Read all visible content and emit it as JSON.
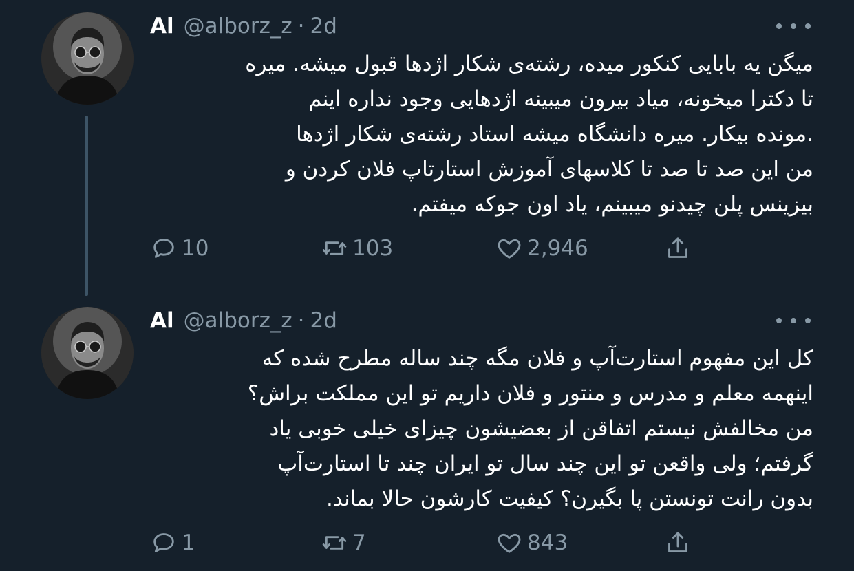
{
  "tweets": [
    {
      "name": "Al",
      "handle": "@alborz_z",
      "separator": "·",
      "time": "2d",
      "body_lines": [
        "میگن یه بابایی کنکور میده، رشته‌ی شکار اژدها قبول میشه. میره",
        "تا دکترا میخونه، میاد بیرون میبینه اژدهایی وجود نداره اینم",
        ".مونده بیکار. میره دانشگاه میشه استاد رشته‌ی شکار اژدها",
        "من این صد تا صد تا کلاسهای آموزش استارتاپ فلان کردن و",
        "بیزینس پلن چیدنو میبینم، یاد اون جوکه میفتم."
      ],
      "replies": "10",
      "retweets": "103",
      "likes": "2,946"
    },
    {
      "name": "Al",
      "handle": "@alborz_z",
      "separator": "·",
      "time": "2d",
      "body_lines": [
        "کل این مفهوم استارت‌آپ و فلان مگه چند ساله مطرح شده که",
        "اینهمه معلم و مدرس و منتور و فلان داریم تو این مملکت براش؟",
        "من مخالفش نیستم اتفاقن از بعضیشون چیزای خیلی خوبی یاد",
        "گرفتم؛ ولی واقعن تو این چند سال تو ایران چند تا استارت‌آپ",
        "بدون رانت تونستن پا بگیرن؟ کیفیت کارشون حالا بماند."
      ],
      "replies": "1",
      "retweets": "7",
      "likes": "843"
    }
  ],
  "icons": {
    "reply": "reply-icon",
    "retweet": "retweet-icon",
    "like": "heart-icon",
    "share": "share-icon",
    "more": "more-icon"
  },
  "colors": {
    "background": "#15202b",
    "text": "#ffffff",
    "muted": "#8899a6",
    "thread_line": "#3d5466"
  }
}
